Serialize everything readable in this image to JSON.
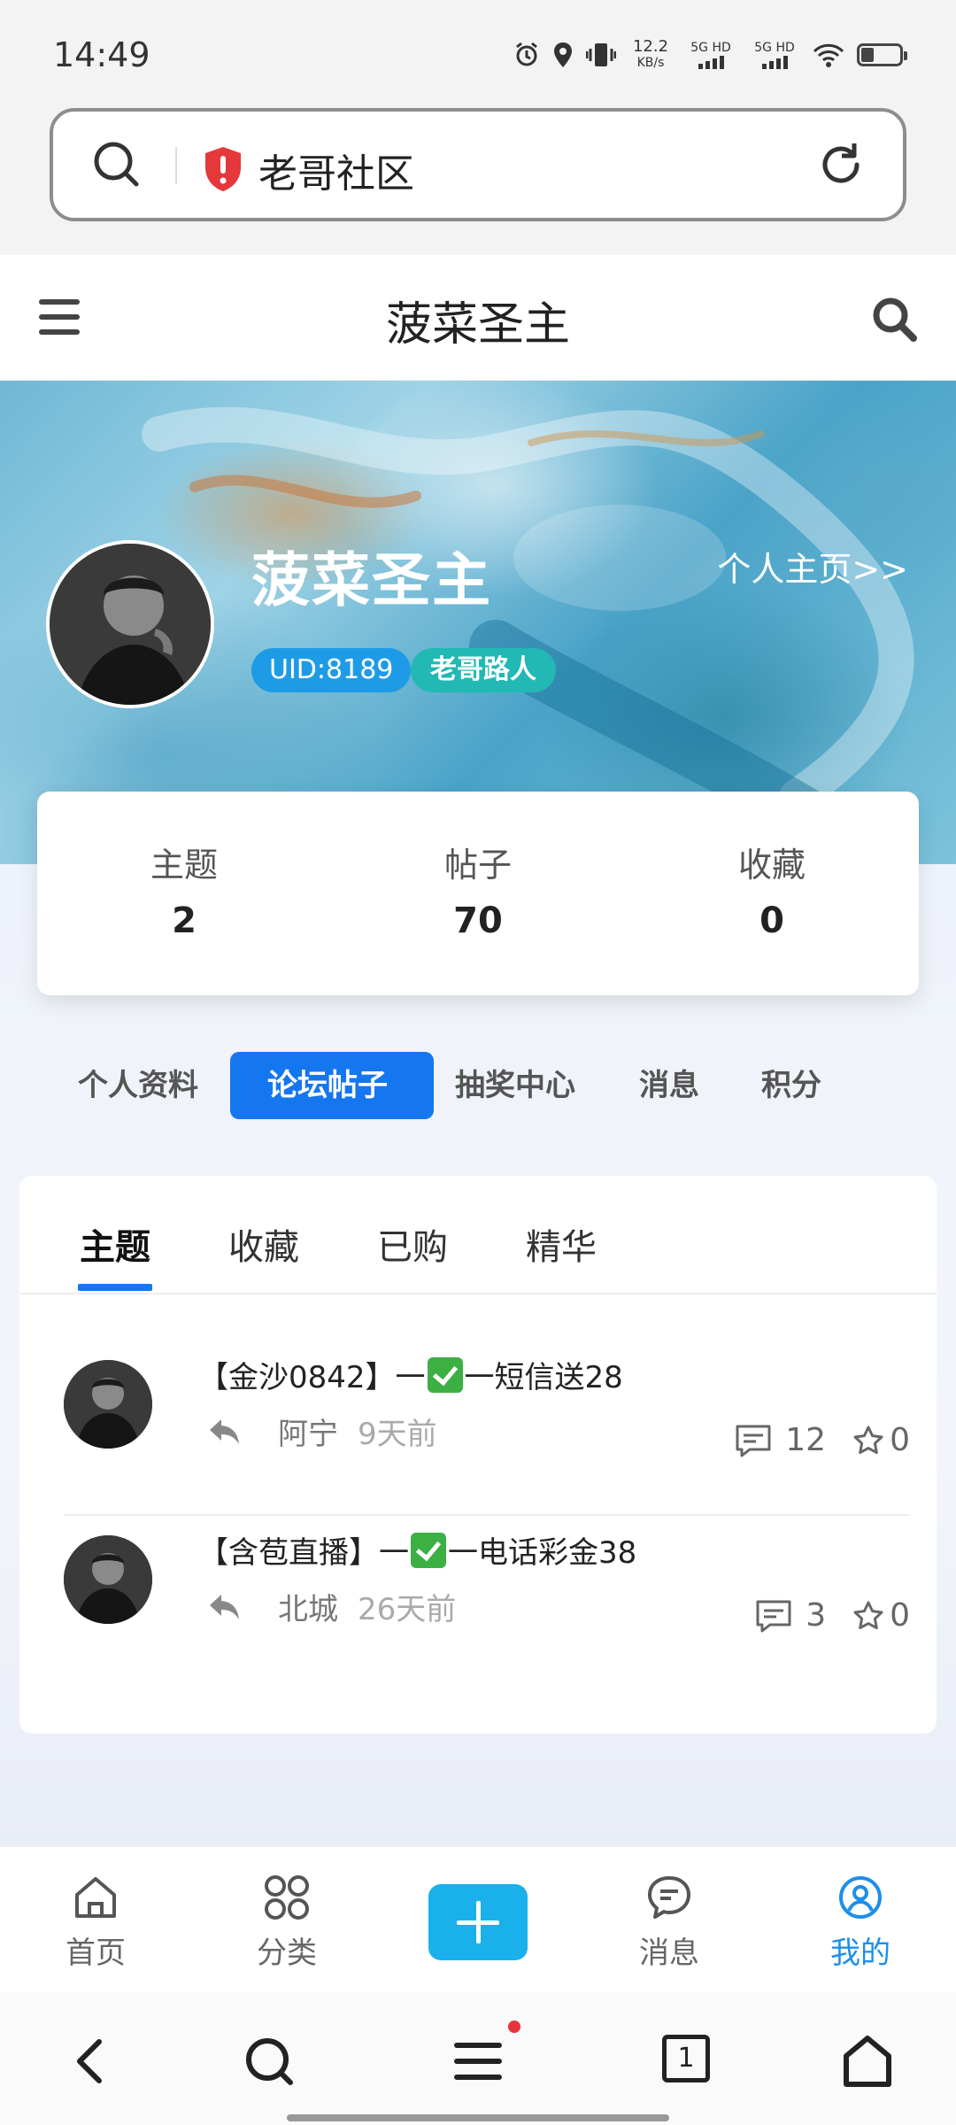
{
  "status_bar": {
    "time": "14:49",
    "speed_value": "12.2",
    "speed_unit": "KB/s",
    "net1": "5G HD",
    "net2": "5G HD"
  },
  "address_bar": {
    "text": "老哥社区"
  },
  "app_header": {
    "title": "菠菜圣主"
  },
  "profile": {
    "name": "菠菜圣主",
    "uid": "UID:8189",
    "rank": "老哥路人",
    "home_link": "个人主页>>"
  },
  "stats": [
    {
      "label": "主题",
      "value": "2"
    },
    {
      "label": "帖子",
      "value": "70"
    },
    {
      "label": "收藏",
      "value": "0"
    }
  ],
  "nav_pills": [
    {
      "label": "个人资料",
      "active": false
    },
    {
      "label": "论坛帖子",
      "active": true
    },
    {
      "label": "抽奖中心",
      "active": false
    },
    {
      "label": "消息",
      "active": false
    },
    {
      "label": "积分",
      "active": false
    }
  ],
  "tabs": [
    {
      "label": "主题",
      "active": true
    },
    {
      "label": "收藏",
      "active": false
    },
    {
      "label": "已购",
      "active": false
    },
    {
      "label": "精华",
      "active": false
    }
  ],
  "posts": [
    {
      "title_before": "【金沙0842】一",
      "title_after": "一短信送28",
      "author": "阿宁",
      "time": "9天前",
      "comments": "12",
      "favorites": "0"
    },
    {
      "title_before": "【含苞直播】一",
      "title_after": "一电话彩金38",
      "author": "北城",
      "time": "26天前",
      "comments": "3",
      "favorites": "0"
    }
  ],
  "bottom_nav": [
    {
      "label": "首页",
      "icon": "home-icon",
      "active": false
    },
    {
      "label": "分类",
      "icon": "grid-icon",
      "active": false
    },
    {
      "label": "",
      "icon": "plus-icon",
      "active": false
    },
    {
      "label": "消息",
      "icon": "chat-icon",
      "active": false
    },
    {
      "label": "我的",
      "icon": "user-icon",
      "active": true
    }
  ],
  "browser_bar": {
    "tab_count": "1"
  },
  "colors": {
    "accent": "#1577f0",
    "uid_badge": "#1e9be6",
    "rank_badge": "#22b8b4",
    "add_button": "#1ab0ec"
  }
}
